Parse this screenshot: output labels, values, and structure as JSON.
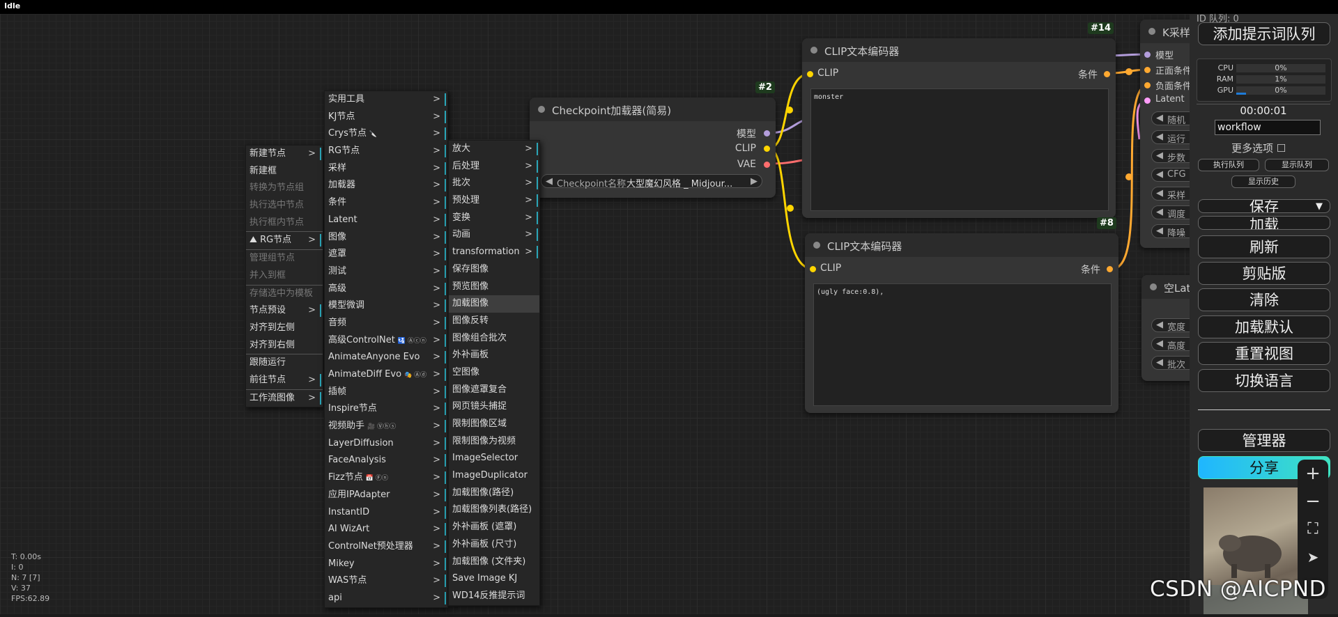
{
  "status": {
    "title": "Idle"
  },
  "stats": {
    "t": "T: 0.00s",
    "i": "I: 0",
    "n": "N: 7 [7]",
    "v": "V: 37",
    "fps": "FPS:62.89"
  },
  "nodes": {
    "checkpoint": {
      "id": "#2",
      "title": "Checkpoint加载器(简易)",
      "out_model": "模型",
      "out_clip": "CLIP",
      "out_vae": "VAE",
      "widget_label": "Checkpoint名称",
      "widget_value": "大型魔幻风格 _ Midjour..."
    },
    "clip_pos": {
      "id": "#14",
      "title": "CLIP文本编码器",
      "in_clip": "CLIP",
      "out": "条件",
      "text": "monster"
    },
    "clip_neg": {
      "id": "#8",
      "title": "CLIP文本编码器",
      "in_clip": "CLIP",
      "out": "条件",
      "text": "(ugly face:0.8),"
    },
    "ksampler": {
      "title": "K采样",
      "inputs": [
        "模型",
        "正面条件",
        "负面条件",
        "Latent"
      ],
      "widgets": [
        "随机",
        "运行",
        "步数",
        "CFG",
        "采样",
        "调度",
        "降噪"
      ]
    },
    "empty_latent": {
      "title": "空Lat",
      "widgets": [
        "宽度",
        "高度",
        "批次"
      ]
    }
  },
  "menu1": {
    "items": [
      {
        "label": "新建节点",
        "sub": true
      },
      {
        "label": "新建框"
      },
      {
        "label": "转换为节点组",
        "disabled": true
      },
      {
        "label": "执行选中节点",
        "disabled": true
      },
      {
        "label": "执行框内节点",
        "disabled": true
      },
      {
        "label": "RG节点",
        "sub": true,
        "sep": true,
        "icon": true
      },
      {
        "label": "管理组节点",
        "disabled": true,
        "sep": true
      },
      {
        "label": "并入到框",
        "disabled": true
      },
      {
        "label": "存储选中为模板",
        "disabled": true,
        "sep": true
      },
      {
        "label": "节点预设",
        "sub": true
      },
      {
        "label": "对齐到左侧"
      },
      {
        "label": "对齐到右侧"
      },
      {
        "label": "跟随运行",
        "sep": true
      },
      {
        "label": "前往节点",
        "sub": true
      },
      {
        "label": "工作流图像",
        "sub": true,
        "sep": true
      }
    ]
  },
  "menu2": {
    "items": [
      {
        "label": "实用工具",
        "sub": true
      },
      {
        "label": "KJ节点",
        "sub": true
      },
      {
        "label": "Crys节点",
        "sub": true,
        "mark": "🔪"
      },
      {
        "label": "RG节点",
        "sub": true
      },
      {
        "label": "采样",
        "sub": true
      },
      {
        "label": "加载器",
        "sub": true
      },
      {
        "label": "条件",
        "sub": true
      },
      {
        "label": "Latent",
        "sub": true
      },
      {
        "label": "图像",
        "sub": true
      },
      {
        "label": "遮罩",
        "sub": true
      },
      {
        "label": "测试",
        "sub": true
      },
      {
        "label": "高级",
        "sub": true
      },
      {
        "label": "模型微调",
        "sub": true
      },
      {
        "label": "音频",
        "sub": true
      },
      {
        "label": "高级ControlNet",
        "sub": true,
        "mark": "🛂 Ⓐⓒⓝ"
      },
      {
        "label": "AnimateAnyone Evo",
        "sub": true
      },
      {
        "label": "AnimateDiff Evo",
        "sub": true,
        "mark": "🎭 Ⓐⓓ"
      },
      {
        "label": "插帧",
        "sub": true
      },
      {
        "label": "Inspire节点",
        "sub": true
      },
      {
        "label": "视频助手",
        "sub": true,
        "mark": "🎥 Ⓥⓗⓢ"
      },
      {
        "label": "LayerDiffusion",
        "sub": true
      },
      {
        "label": "FaceAnalysis",
        "sub": true
      },
      {
        "label": "Fizz节点",
        "sub": true,
        "mark": "📅 Ⓕⓝ"
      },
      {
        "label": "应用IPAdapter",
        "sub": true
      },
      {
        "label": "InstantID",
        "sub": true
      },
      {
        "label": "AI WizArt",
        "sub": true
      },
      {
        "label": "ControlNet预处理器",
        "sub": true
      },
      {
        "label": "Mikey",
        "sub": true
      },
      {
        "label": "WAS节点",
        "sub": true
      },
      {
        "label": "api",
        "sub": true
      }
    ]
  },
  "menu3": {
    "items": [
      {
        "label": "放大",
        "sub": true
      },
      {
        "label": "后处理",
        "sub": true
      },
      {
        "label": "批次",
        "sub": true
      },
      {
        "label": "预处理",
        "sub": true
      },
      {
        "label": "变换",
        "sub": true
      },
      {
        "label": "动画",
        "sub": true
      },
      {
        "label": "transformation",
        "sub": true
      },
      {
        "label": "保存图像"
      },
      {
        "label": "预览图像"
      },
      {
        "label": "加载图像",
        "highlight": true
      },
      {
        "label": "图像反转"
      },
      {
        "label": "图像组合批次"
      },
      {
        "label": "外补画板"
      },
      {
        "label": "空图像"
      },
      {
        "label": "图像遮罩复合"
      },
      {
        "label": "网页镜头捕捉"
      },
      {
        "label": "限制图像区域"
      },
      {
        "label": "限制图像为视频"
      },
      {
        "label": "ImageSelector"
      },
      {
        "label": "ImageDuplicator"
      },
      {
        "label": "加载图像(路径)"
      },
      {
        "label": "加载图像列表(路径)"
      },
      {
        "label": "外补画板 (遮罩)"
      },
      {
        "label": "外补画板 (尺寸)"
      },
      {
        "label": "加载图像 (文件夹)"
      },
      {
        "label": "Save Image KJ"
      },
      {
        "label": "WD14反推提示词"
      }
    ]
  },
  "panel": {
    "top_label": "ID 队列: 0",
    "queue_prompt": "添加提示词队列",
    "monitor": [
      {
        "label": "CPU",
        "value": "0%"
      },
      {
        "label": "RAM",
        "value": "1%"
      },
      {
        "label": "GPU",
        "value": "0%"
      }
    ],
    "timer": "00:00:01",
    "workflow_name": "workflow",
    "more_options": "更多选项",
    "exec_queue": "执行队列",
    "show_queue": "显示队列",
    "show_history": "显示历史",
    "save": "保存",
    "load": "加载",
    "refresh": "刷新",
    "clipspace": "剪贴版",
    "clear": "清除",
    "load_default": "加载默认",
    "reset_view": "重置视图",
    "switch_lang": "切换语言",
    "manager": "管理器",
    "share": "分享"
  },
  "zoom": {
    "plus": "+",
    "minus": "−",
    "fit": "⛶",
    "send": "➤"
  },
  "watermark": "CSDN @AICPND",
  "colors": {
    "model": "#b39ddb",
    "clip": "#ffd500",
    "vae": "#ff6e6e",
    "cond": "#ffa931",
    "latent": "#ff9cf9",
    "menu_accent": "#2aa6b8"
  }
}
